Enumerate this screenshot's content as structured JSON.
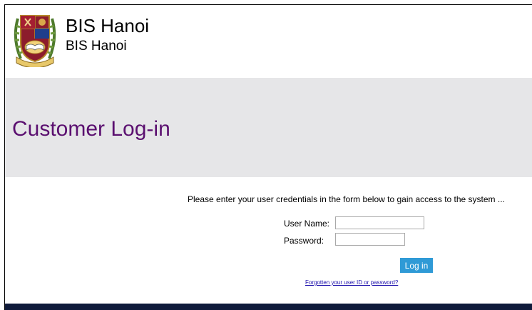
{
  "header": {
    "org_name": "BIS Hanoi",
    "org_subtitle": "BIS Hanoi",
    "crest_icon": "school-crest-icon",
    "crest_motto": "QUAERERE SCIENTIAM"
  },
  "banner": {
    "title": "Customer Log-in"
  },
  "login_form": {
    "instructions": "Please enter your user credentials in the form below to gain access to the system ...",
    "username_label": "User Name:",
    "username_value": "",
    "password_label": "Password:",
    "password_value": "",
    "login_button": "Log in",
    "forgot_link": "Forgotten your user ID or password?"
  },
  "colors": {
    "title": "#5b1070",
    "banner_bg": "#e6e6e8",
    "button_bg": "#2f9ad6",
    "link": "#1a0dab",
    "footer_bg": "#101b3b"
  }
}
